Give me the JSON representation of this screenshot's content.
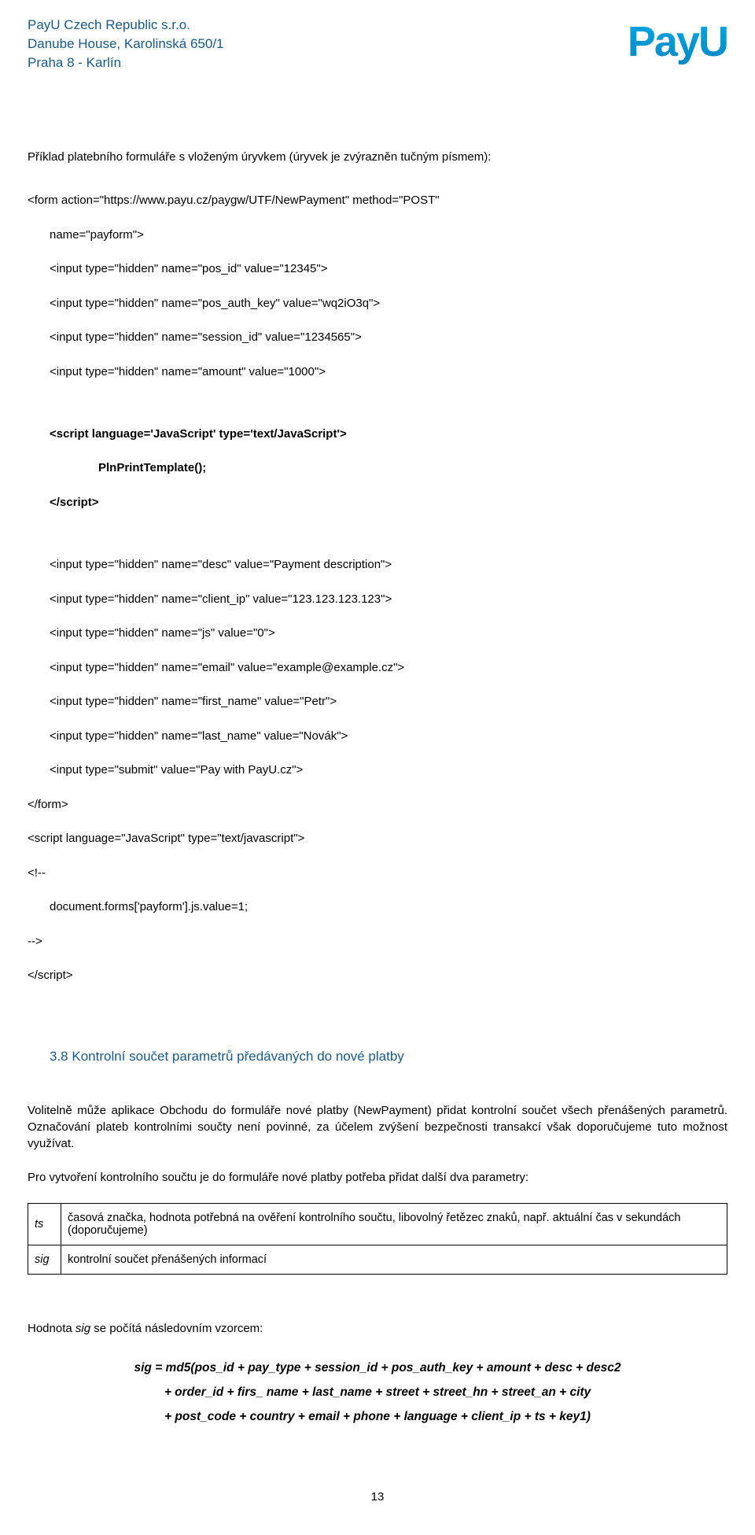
{
  "header": {
    "company": "PayU Czech Republic s.r.o.",
    "address1": "Danube House, Karolinská 650/1",
    "address2": "Praha 8 - Karlín"
  },
  "intro": "Příklad platebního formuláře s vloženým úryvkem (úryvek je zvýrazněn tučným písmem):",
  "code": {
    "l1": "<form action=\"https://www.payu.cz/paygw/UTF/NewPayment\" method=\"POST\"",
    "l2": "name=\"payform\">",
    "l3": "<input type=\"hidden\" name=\"pos_id\" value=\"12345\">",
    "l4": "<input type=\"hidden\" name=\"pos_auth_key\" value=\"wq2iO3q\">",
    "l5": "<input type=\"hidden\" name=\"session_id\" value=\"1234565\">",
    "l6": "<input type=\"hidden\" name=\"amount\" value=\"1000\">",
    "b1": "<script language='JavaScript' type='text/JavaScript'>",
    "b2": "PlnPrintTemplate();",
    "b3": "</script>",
    "l7": "<input type=\"hidden\" name=\"desc\" value=\"Payment description\">",
    "l8": "<input type=\"hidden\" name=\"client_ip\" value=\"123.123.123.123\">",
    "l9": "<input type=\"hidden\" name=\"js\" value=\"0\">",
    "l10": "<input type=\"hidden\" name=\"email\" value=\"example@example.cz\">",
    "l11": "<input type=\"hidden\" name=\"first_name\" value=\"Petr\">",
    "l12": "<input type=\"hidden\" name=\"last_name\" value=\"Novák\">",
    "l13": "<input type=\"submit\" value=\"Pay with PayU.cz\">",
    "l14": "</form>",
    "l15": "<script language=\"JavaScript\" type=\"text/javascript\">",
    "l16": "<!--",
    "l17": "document.forms['payform'].js.value=1;",
    "l18": "-->",
    "l19": "</script>"
  },
  "section_heading": "3.8 Kontrolní součet parametrů předávaných do nové platby",
  "para1": "Volitelně může aplikace Obchodu do formuláře nové platby (NewPayment) přidat kontrolní součet všech přenášených parametrů. Označování plateb kontrolními součty není povinné, za účelem zvýšení bezpečnosti transakcí však doporučujeme tuto možnost využívat.",
  "para2": "Pro vytvoření kontrolního součtu je do formuláře nové platby potřeba přidat další dva parametry:",
  "table": {
    "rows": [
      {
        "key": "ts",
        "desc": "časová značka, hodnota potřebná na ověření kontrolního součtu, libovolný řetězec znaků, např. aktuální čas v sekundách (doporučujeme)"
      },
      {
        "key": "sig",
        "desc": "kontrolní součet přenášených informací"
      }
    ]
  },
  "formula_intro_pre": "Hodnota ",
  "formula_intro_sig": "sig",
  "formula_intro_post": " se počítá následovním vzorcem:",
  "formula": {
    "l1": "sig = md5(pos_id + pay_type + session_id + pos_auth_key + amount + desc + desc2",
    "l2": "+ order_id + firs_ name + last_name + street + street_hn + street_an + city",
    "l3": "+ post_code + country + email + phone + language + client_ip + ts + key1)"
  },
  "page_number": "13"
}
